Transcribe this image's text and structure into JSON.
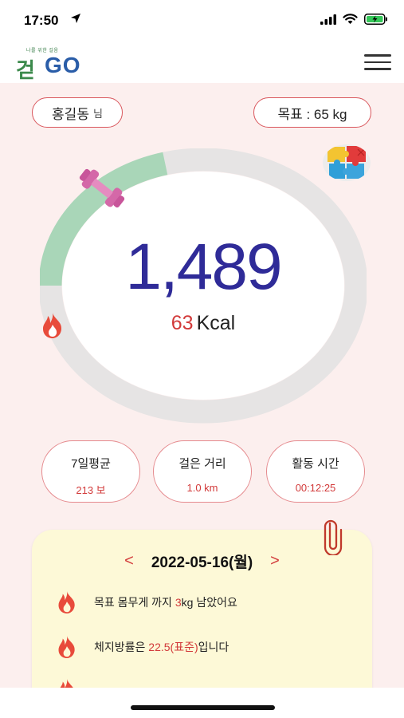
{
  "status_bar": {
    "time": "17:50"
  },
  "header": {
    "logo_main": "걷",
    "logo_accent": "GO",
    "logo_tagline": "나를 위한 걸음"
  },
  "user": {
    "name": "홍길동",
    "suffix": "님"
  },
  "goal": {
    "label": "목표 : 65 kg"
  },
  "progress": {
    "steps": "1,489",
    "calories_value": "63",
    "calories_unit": "Kcal",
    "ring_fraction": 0.21
  },
  "stats": [
    {
      "label": "7일평균",
      "value": "213 보"
    },
    {
      "label": "걸은 거리",
      "value": "1.0 km"
    },
    {
      "label": "활동 시간",
      "value": "00:12:25"
    }
  ],
  "card": {
    "prev": "<",
    "date": "2022-05-16(월)",
    "next": ">",
    "notes": [
      {
        "before": "목표 몸무게 까지 ",
        "highlight": "3",
        "after": "kg 남았어요"
      },
      {
        "before": "체지방률은 ",
        "highlight": "22.5(표준)",
        "after": "입니다"
      }
    ]
  },
  "colors": {
    "accent": "#d23a3a",
    "steps": "#2f2b98",
    "ring_progress": "#a9d6b8",
    "background": "#fcefee",
    "card": "#fdf9d7"
  },
  "icons": [
    "location-arrow-icon",
    "signal-icon",
    "wifi-icon",
    "battery-icon",
    "menu-icon",
    "puzzle-icon",
    "dumbbell-icon",
    "flame-icon",
    "paperclip-icon"
  ]
}
